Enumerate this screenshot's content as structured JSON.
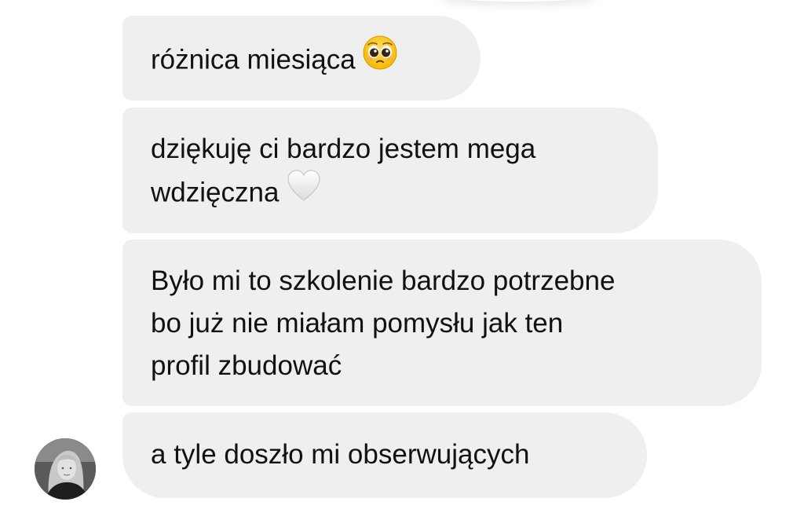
{
  "messages": [
    {
      "line1": "różnica miesiąca",
      "emoji": "pleading-face-emoji"
    },
    {
      "line1": "dziękuję ci bardzo jestem mega",
      "line2": "wdzięczna",
      "emoji": "white-heart-emoji"
    },
    {
      "line1": "Było mi to szkolenie bardzo potrzebne",
      "line2": "bo już nie miałam pomysłu jak ten",
      "line3": "profil zbudować"
    },
    {
      "line1": "a tyle doszło mi obserwujących"
    }
  ],
  "colors": {
    "bubble_bg": "#efefef",
    "text": "#111111",
    "background": "#ffffff"
  },
  "icons": {
    "avatar": "avatar"
  }
}
